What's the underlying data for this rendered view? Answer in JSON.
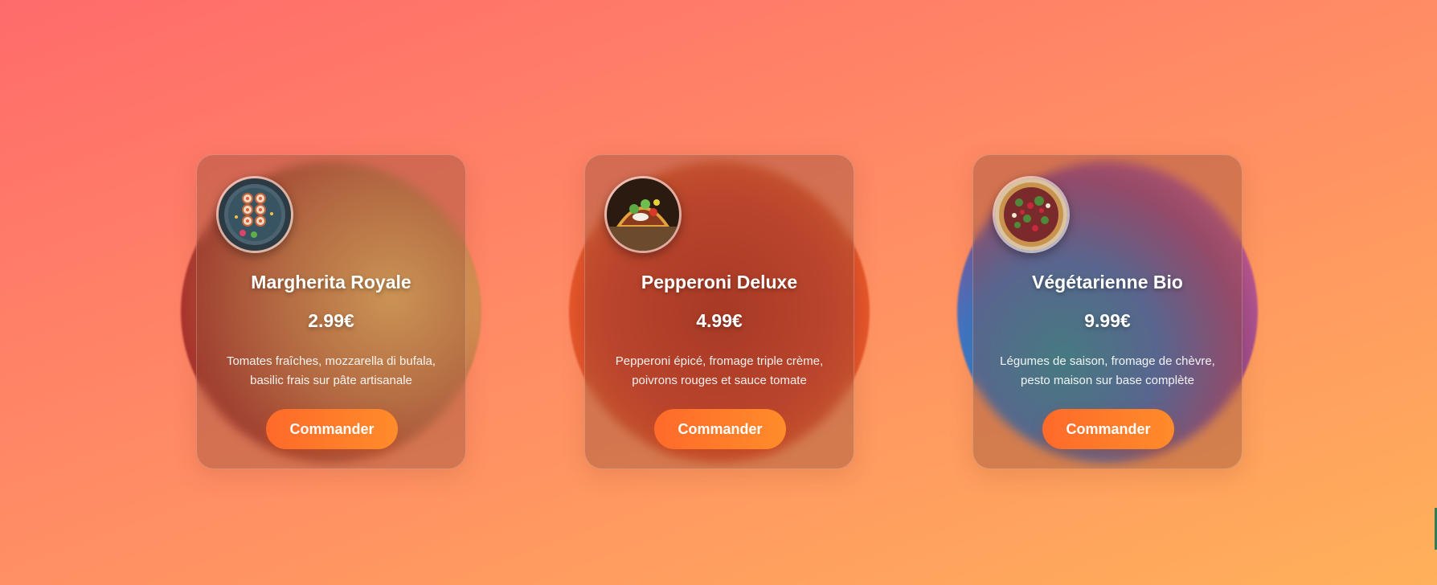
{
  "products": [
    {
      "name": "Margherita Royale",
      "price": "2.99€",
      "description": "Tomates fraîches, mozzarella di bufala, basilic frais sur pâte artisanale",
      "button_label": "Commander",
      "thumbnail_icon": "sushi-plate-icon",
      "blob_colors": [
        "#c0392b",
        "#f5c96b"
      ]
    },
    {
      "name": "Pepperoni Deluxe",
      "price": "4.99€",
      "description": "Pepperoni épicé, fromage triple crème, poivrons rouges et sauce tomate",
      "button_label": "Commander",
      "thumbnail_icon": "tacos-icon",
      "blob_colors": [
        "#ff7a2e",
        "#e8432a"
      ]
    },
    {
      "name": "Végétarienne Bio",
      "price": "9.99€",
      "description": "Légumes de saison, fromage de chèvre, pesto maison sur base complète",
      "button_label": "Commander",
      "thumbnail_icon": "vegetable-pizza-icon",
      "blob_colors": [
        "#2aa7e0",
        "#ff6fa0"
      ]
    }
  ],
  "colors": {
    "background_start": "#ff6b6b",
    "background_end": "#ffb05a",
    "button_start": "#ff6a2a",
    "button_end": "#ff8c2a"
  }
}
